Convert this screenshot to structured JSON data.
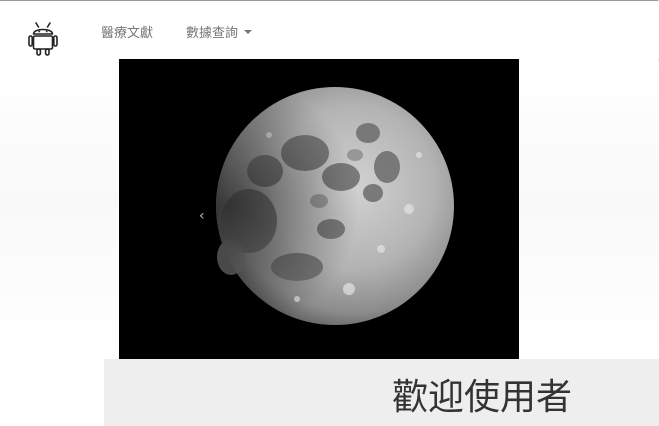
{
  "navbar": {
    "brand_icon": "android-icon",
    "links": {
      "docs": "醫療文獻",
      "query": "數據查詢"
    }
  },
  "carousel": {
    "slide_image": "moon-photo",
    "prev_control": "‹"
  },
  "jumbotron": {
    "welcome": "歡迎使用者"
  },
  "colors": {
    "nav_text": "#777777",
    "carousel_bg": "#000000",
    "welcome_bg": "#eeeeee",
    "welcome_text": "#333333"
  }
}
